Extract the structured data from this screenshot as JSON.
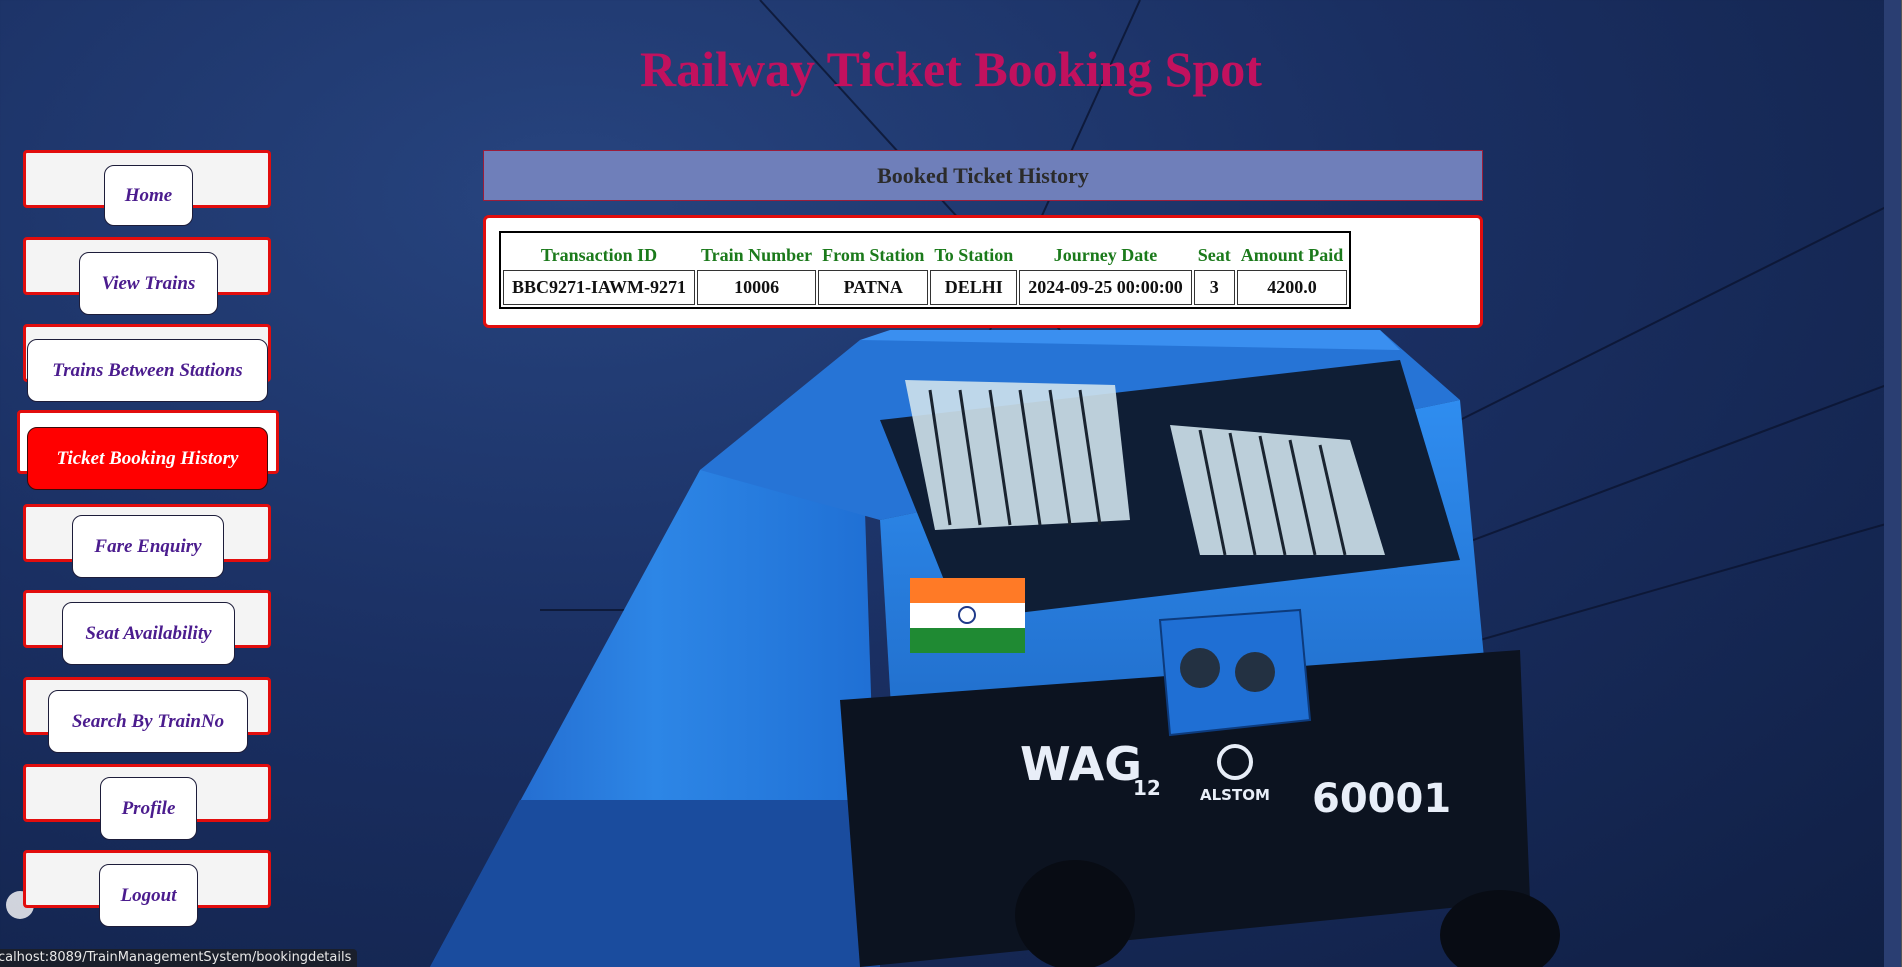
{
  "title": "Railway Ticket Booking Spot",
  "sidebar": {
    "items": [
      {
        "label": "Home",
        "active": false
      },
      {
        "label": "View Trains",
        "active": false
      },
      {
        "label": "Trains Between Stations",
        "active": false
      },
      {
        "label": "Ticket Booking History",
        "active": true
      },
      {
        "label": "Fare Enquiry",
        "active": false
      },
      {
        "label": "Seat Availability",
        "active": false
      },
      {
        "label": "Search By TrainNo",
        "active": false
      },
      {
        "label": "Profile",
        "active": false
      },
      {
        "label": "Logout",
        "active": false
      }
    ]
  },
  "panel": {
    "header": "Booked Ticket History",
    "table": {
      "columns": [
        "Transaction ID",
        "Train Number",
        "From Station",
        "To Station",
        "Journey Date",
        "Seat",
        "Amount Paid"
      ],
      "rows": [
        [
          "BBC9271-IAWM-9271",
          "10006",
          "PATNA",
          "DELHI",
          "2024-09-25 00:00:00",
          "3",
          "4200.0"
        ]
      ]
    }
  },
  "background": {
    "locomotive": {
      "model": "WAG",
      "model_sub": "12",
      "maker": "ALSTOM",
      "number": "60001"
    }
  },
  "status_bar": "ocalhost:8089/TrainManagementSystem/bookingdetails",
  "colors": {
    "title": "#c2115e",
    "nav_border": "#e20d0d",
    "nav_text": "#4b1c8e",
    "active_bg": "#ff0000",
    "header_bg": "#6f7fba",
    "table_header_text": "#1b7a1b"
  }
}
